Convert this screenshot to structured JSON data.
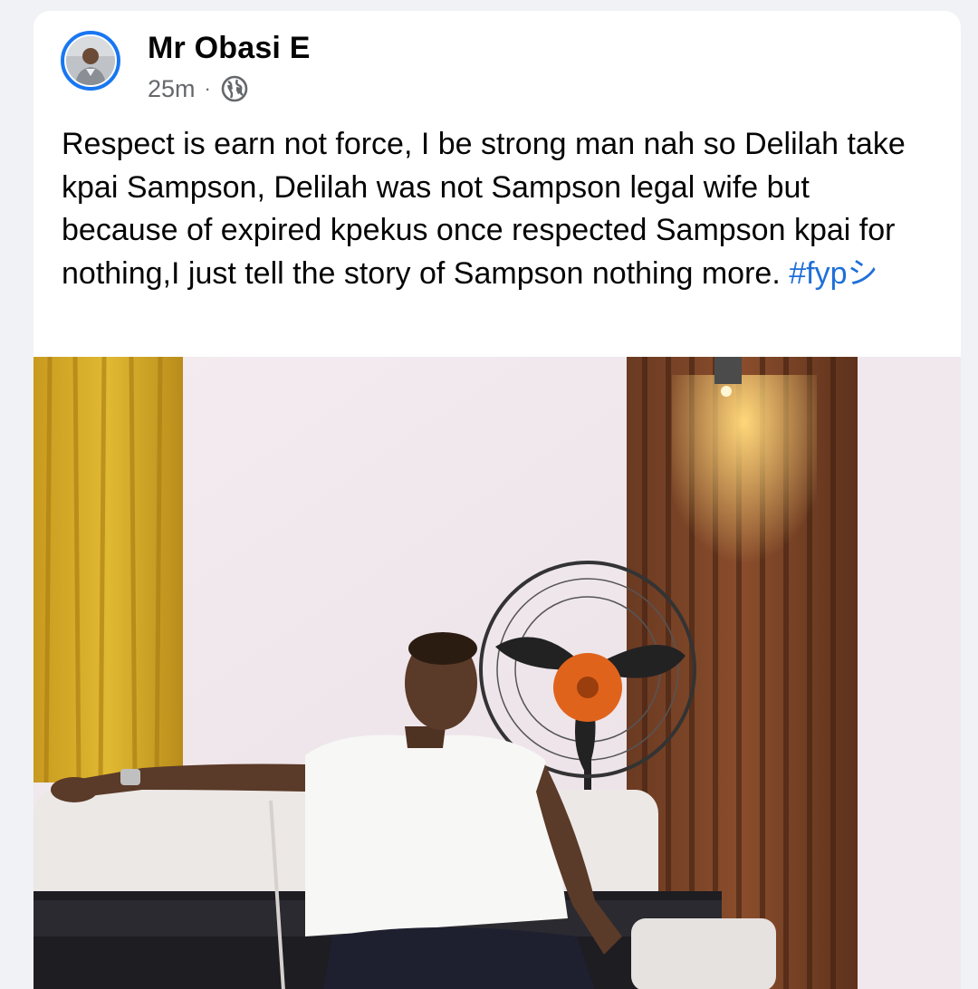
{
  "post": {
    "author": "Mr Obasi E",
    "time": "25m",
    "separator": "·",
    "audience_icon": "globe-icon",
    "text": "Respect is earn not force, I be strong man nah so Delilah take kpai Sampson, Delilah was not Sampson legal wife but because of expired kpekus once respected Sampson kpai for nothing,I just tell the story of Sampson nothing more. ",
    "hashtag": "#fypシ",
    "photo_description_icon": "post-photo"
  },
  "colors": {
    "accent": "#1877f2",
    "hashtag": "#1f6fd8",
    "meta": "#65676b"
  }
}
